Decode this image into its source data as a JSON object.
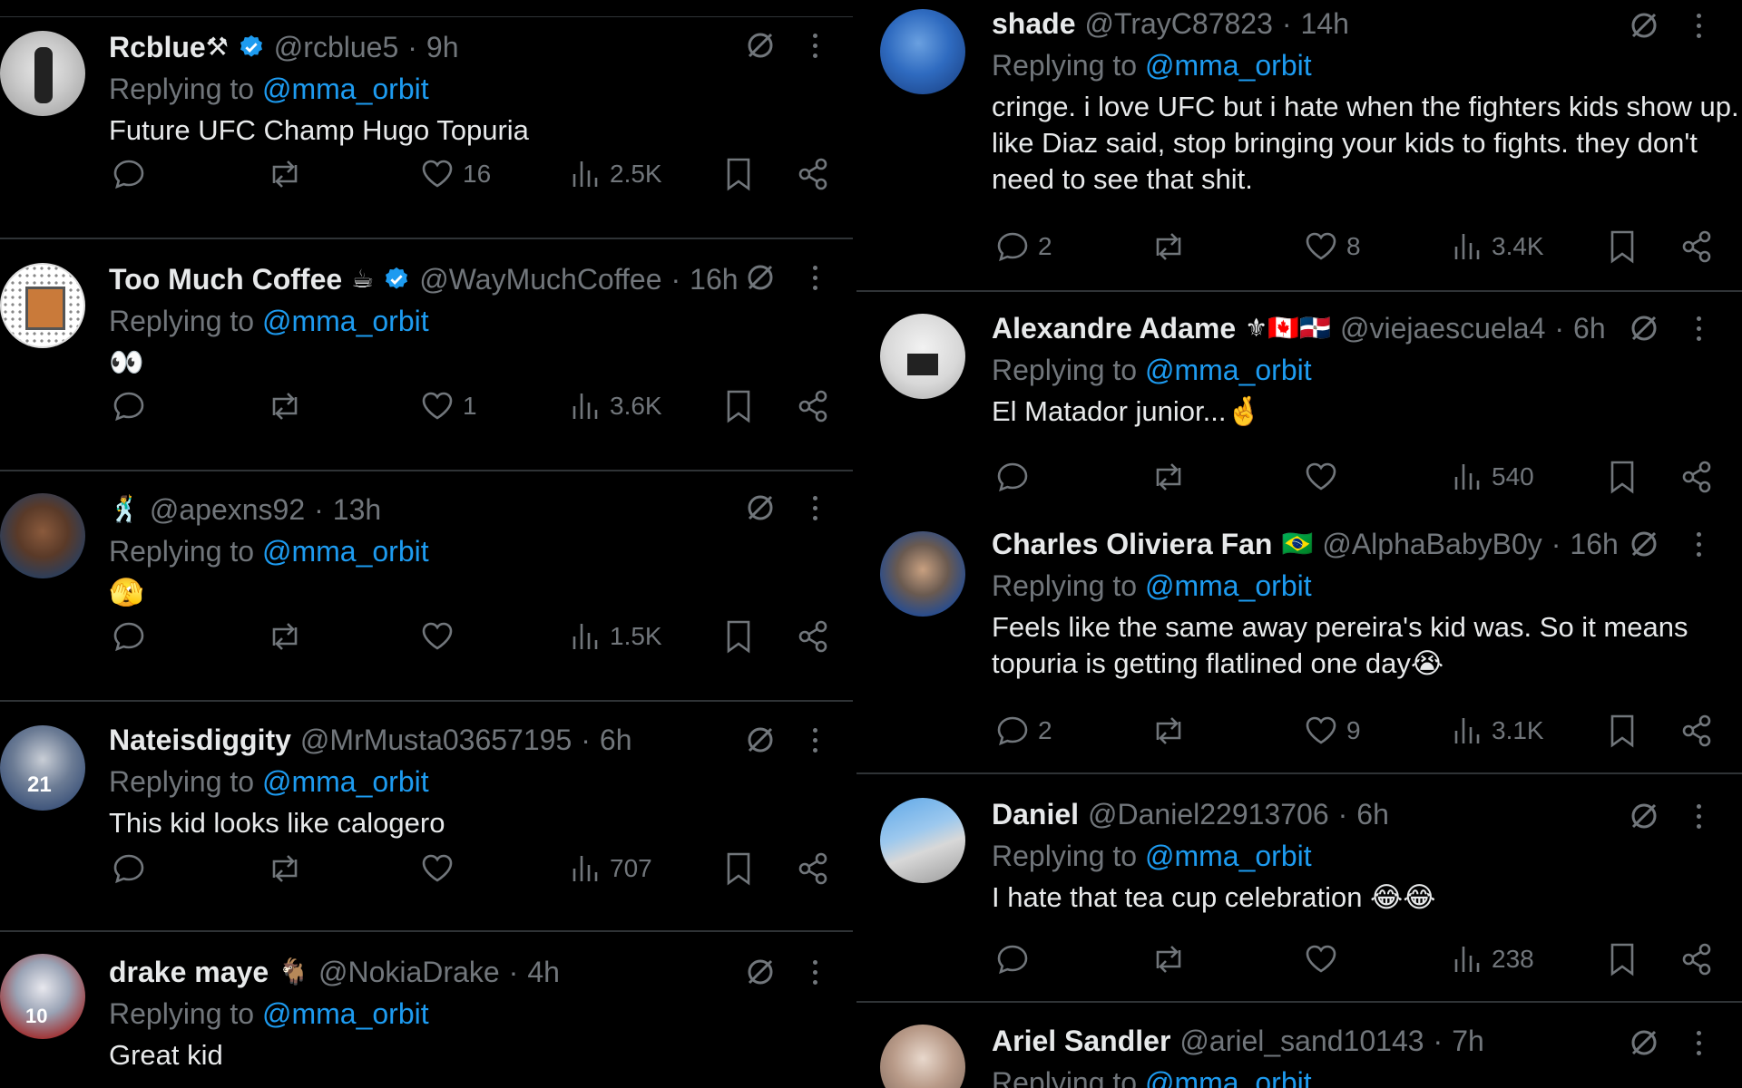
{
  "reply_prefix": "Replying to",
  "colors": {
    "accent": "#1d9bf0",
    "muted": "#71767b",
    "text": "#e7e9ea",
    "bg": "#000000",
    "verified": "#1d9bf0"
  },
  "left": [
    {
      "name": "Rcblue",
      "name_emoji": "⚒",
      "verified": true,
      "handle": "@rcblue5",
      "time": "9h",
      "mention": "@mma_orbit",
      "text": "Future UFC Champ Hugo Topuria",
      "replies": "",
      "likes": "16",
      "views": "2.5K"
    },
    {
      "name": "Too Much Coffee",
      "name_emoji": "☕",
      "verified": true,
      "handle": "@WayMuchCoffee",
      "time": "16h",
      "mention": "@mma_orbit",
      "text": "👀",
      "replies": "",
      "likes": "1",
      "views": "3.6K"
    },
    {
      "name": "",
      "name_emoji": "🕺",
      "verified": false,
      "handle": "@apexns92",
      "time": "13h",
      "mention": "@mma_orbit",
      "text": "🫣",
      "replies": "",
      "likes": "",
      "views": "1.5K"
    },
    {
      "name": "Nateisdiggity",
      "name_emoji": "",
      "verified": false,
      "handle": "@MrMusta03657195",
      "time": "6h",
      "mention": "@mma_orbit",
      "text": "This kid looks like calogero",
      "replies": "",
      "likes": "",
      "views": "707"
    },
    {
      "name": "drake maye",
      "name_emoji": "🐐",
      "verified": false,
      "handle": "@NokiaDrake",
      "time": "4h",
      "mention": "@mma_orbit",
      "text": "Great kid",
      "replies": "",
      "likes": "",
      "views": ""
    }
  ],
  "right": [
    {
      "name": "shade",
      "name_emoji": "",
      "verified": false,
      "handle": "@TrayC87823",
      "time": "14h",
      "mention": "@mma_orbit",
      "text": "cringe. i love UFC but i hate when the fighters kids show up. like Diaz said, stop bringing your kids to fights. they don't need to see that shit.",
      "replies": "2",
      "likes": "8",
      "views": "3.4K"
    },
    {
      "name": "Alexandre Adame",
      "name_emoji": "⚜🇨🇦🇩🇴",
      "verified": false,
      "handle": "@viejaescuela4",
      "time": "6h",
      "mention": "@mma_orbit",
      "text": "El Matador junior...🤞",
      "replies": "",
      "likes": "",
      "views": "540"
    },
    {
      "name": "Charles Oliviera Fan",
      "name_emoji": "🇧🇷",
      "verified": false,
      "handle": "@AlphaBabyB0y",
      "time": "16h",
      "mention": "@mma_orbit",
      "text": "Feels like the same away pereira's kid was. So it means topuria is getting flatlined one day😭",
      "replies": "2",
      "likes": "9",
      "views": "3.1K"
    },
    {
      "name": "Daniel",
      "name_emoji": "",
      "verified": false,
      "handle": "@Daniel22913706",
      "time": "6h",
      "mention": "@mma_orbit",
      "text": "I hate that tea cup celebration 😂😂",
      "replies": "",
      "likes": "",
      "views": "238"
    },
    {
      "name": "Ariel Sandler",
      "name_emoji": "",
      "verified": false,
      "handle": "@ariel_sand10143",
      "time": "7h",
      "mention": "@mma_orbit",
      "text": "",
      "replies": "",
      "likes": "",
      "views": ""
    }
  ]
}
